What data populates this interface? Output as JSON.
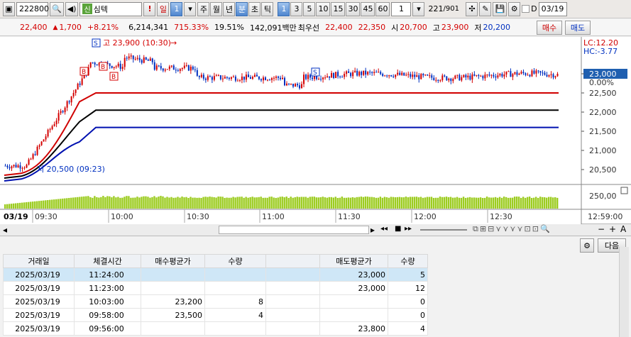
{
  "toolbar": {
    "code": "222800",
    "name_badge": "신",
    "name": "심텍",
    "bang": "!",
    "period_day": "일",
    "period_num": "1",
    "periods": [
      "주",
      "월",
      "년",
      "분",
      "초",
      "틱"
    ],
    "minutes": [
      "1",
      "3",
      "5",
      "10",
      "15",
      "30",
      "45",
      "60"
    ],
    "count": "1",
    "page": "221",
    "page_total": "/901",
    "date_check": "D",
    "date": "03/19"
  },
  "quote": {
    "price": "22,400",
    "change_arrow": "▲",
    "change": "1,700",
    "rate": "+8.21%",
    "volume": "6,214,341",
    "vol_rate": "715.33%",
    "turnover": "19.51%",
    "amount": "142,091백만",
    "best_label": "최우선",
    "best_ask": "22,400",
    "best_bid": "22,350",
    "open_label": "시",
    "open": "20,700",
    "high_label": "고",
    "high": "23,900",
    "low_label": "저",
    "low": "20,200",
    "buy_btn": "매수",
    "sell_btn": "매도"
  },
  "chart": {
    "price_ticks": [
      "23,000",
      "22,500",
      "22,000",
      "21,500",
      "21,000",
      "20,500"
    ],
    "lc": "LC:12.20",
    "hc": "HC:-3.77",
    "current_price": "23,000",
    "current_pct": "0.00%",
    "vol_tick": "250,00",
    "high_annot": "고 23,900 (10:30)",
    "low_annot": "저 20,500 (09:23)",
    "marker_s": "S",
    "marker_b": "B",
    "date_label": "03/19",
    "time_ticks": [
      "09:30",
      "10:00",
      "10:30",
      "11:00",
      "11:30",
      "12:00",
      "12:30"
    ],
    "end_time": "12:59:00"
  },
  "scroll": {
    "left_arrow": "◂",
    "right_arrow": "▸",
    "zoom_out": "−",
    "zoom_in": "+",
    "font_btn": "A"
  },
  "grid": {
    "next_btn": "다음",
    "headers": [
      "거래일",
      "체결시간",
      "매수평균가",
      "수량",
      "",
      "매도평균가",
      "수량"
    ],
    "rows": [
      [
        "2025/03/19",
        "11:24:00",
        "",
        "",
        "",
        "23,000",
        "5"
      ],
      [
        "2025/03/19",
        "11:23:00",
        "",
        "",
        "",
        "23,000",
        "12"
      ],
      [
        "2025/03/19",
        "10:03:00",
        "23,200",
        "8",
        "",
        "",
        "0"
      ],
      [
        "2025/03/19",
        "09:58:00",
        "23,500",
        "4",
        "",
        "",
        "0"
      ],
      [
        "2025/03/19",
        "09:56:00",
        "",
        "",
        "",
        "23,800",
        "4"
      ]
    ]
  },
  "colors": {
    "up": "#d40000",
    "down": "#0030c0",
    "volume": "#9ccc20",
    "ma_red": "#d00000",
    "ma_black": "#000000",
    "ma_blue": "#0010b0",
    "price_box": "#1f5fb0"
  }
}
